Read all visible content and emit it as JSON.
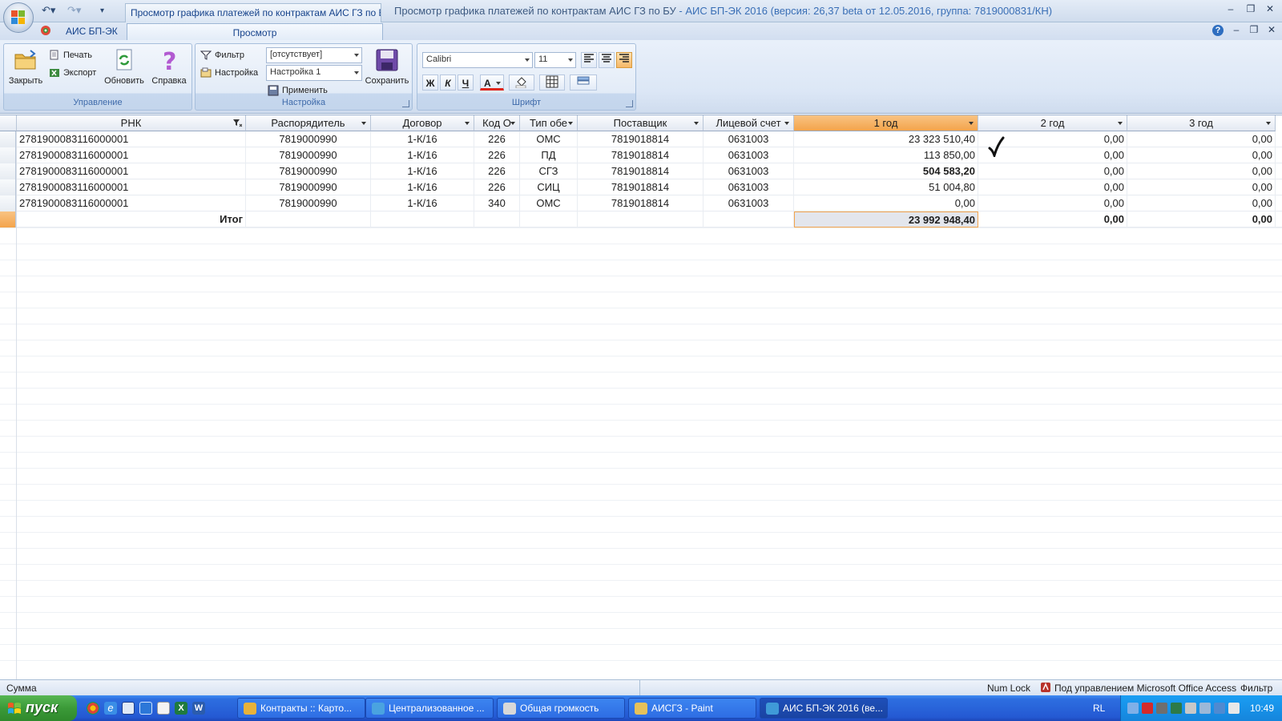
{
  "titlebar": {
    "doc_tab": "Просмотр графика платежей по контрактам АИС ГЗ по БУ",
    "title_main": "Просмотр графика платежей по контрактам АИС ГЗ по БУ",
    "title_suffix": " - АИС БП-ЭК 2016 (версия: 26,37 beta от 12.05.2016, группа: 7819000831/КН)"
  },
  "tabs": {
    "app": "АИС БП-ЭК",
    "view": "Просмотр"
  },
  "ribbon": {
    "manage": {
      "label": "Управление",
      "close": "Закрыть",
      "print": "Печать",
      "export": "Экспорт",
      "refresh": "Обновить",
      "help": "Справка"
    },
    "settings": {
      "label": "Настройка",
      "filter": "Фильтр",
      "filter_value": "[отсутствует]",
      "setup": "Настройка",
      "setup_value": "Настройка 1",
      "apply": "Применить",
      "save": "Сохранить"
    },
    "font": {
      "label": "Шрифт",
      "font_name": "Calibri",
      "font_size": "11",
      "bold": "Ж",
      "italic": "К",
      "underline": "Ч",
      "font_color": "A"
    }
  },
  "grid": {
    "columns": [
      "РНК",
      "Распорядитель",
      "Договор",
      "Код О",
      "Тип обе",
      "Поставщик",
      "Лицевой счет",
      "1 год",
      "2 год",
      "3 год"
    ],
    "rows": [
      [
        "2781900083116000001",
        "7819000990",
        "1-К/16",
        "226",
        "ОМС",
        "7819018814",
        "0631003",
        "23 323 510,40",
        "0,00",
        "0,00"
      ],
      [
        "2781900083116000001",
        "7819000990",
        "1-К/16",
        "226",
        "ПД",
        "7819018814",
        "0631003",
        "113 850,00",
        "0,00",
        "0,00"
      ],
      [
        "2781900083116000001",
        "7819000990",
        "1-К/16",
        "226",
        "СГЗ",
        "7819018814",
        "0631003",
        "504 583,20",
        "0,00",
        "0,00"
      ],
      [
        "2781900083116000001",
        "7819000990",
        "1-К/16",
        "226",
        "СИЦ",
        "7819018814",
        "0631003",
        "51 004,80",
        "0,00",
        "0,00"
      ],
      [
        "2781900083116000001",
        "7819000990",
        "1-К/16",
        "340",
        "ОМС",
        "7819018814",
        "0631003",
        "0,00",
        "0,00",
        "0,00"
      ]
    ],
    "total": {
      "label": "Итог",
      "y1": "23 992 948,40",
      "y2": "0,00",
      "y3": "0,00"
    }
  },
  "statusbar": {
    "left": "Сумма",
    "numlock": "Num Lock",
    "managed": "Под управлением Microsoft Office Access",
    "filter": "Фильтр"
  },
  "taskbar": {
    "start": "пуск",
    "tasks": [
      "Контракты :: Карто...",
      "Централизованное ...",
      "Общая громкость",
      "АИСГЗ - Paint",
      "АИС БП-ЭК 2016 (ве..."
    ],
    "lang": "RL",
    "clock": "10:49"
  },
  "colors": {
    "accent_orange": "#f3a44b",
    "ribbon_blue": "#dce7f6",
    "taskbar_blue": "#2459d3",
    "start_green": "#3b9a38"
  }
}
